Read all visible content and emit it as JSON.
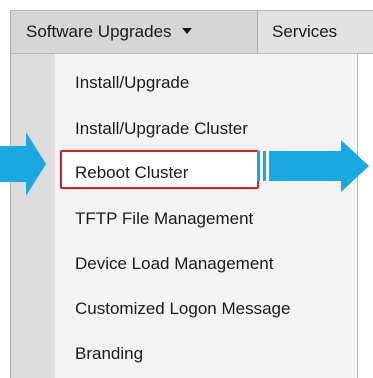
{
  "menubar": {
    "software_upgrades_label": "Software Upgrades",
    "services_label": "Services"
  },
  "dropdown": {
    "items": [
      {
        "label": "Install/Upgrade"
      },
      {
        "label": "Install/Upgrade Cluster"
      },
      {
        "label": "Reboot Cluster"
      },
      {
        "label": "TFTP File Management"
      },
      {
        "label": "Device Load Management"
      },
      {
        "label": "Customized Logon Message"
      },
      {
        "label": "Branding"
      }
    ],
    "highlighted_item": "Reboot Cluster"
  },
  "annotations": {
    "arrow_color": "#1ba8e0",
    "highlight_color": "#c0282b"
  }
}
